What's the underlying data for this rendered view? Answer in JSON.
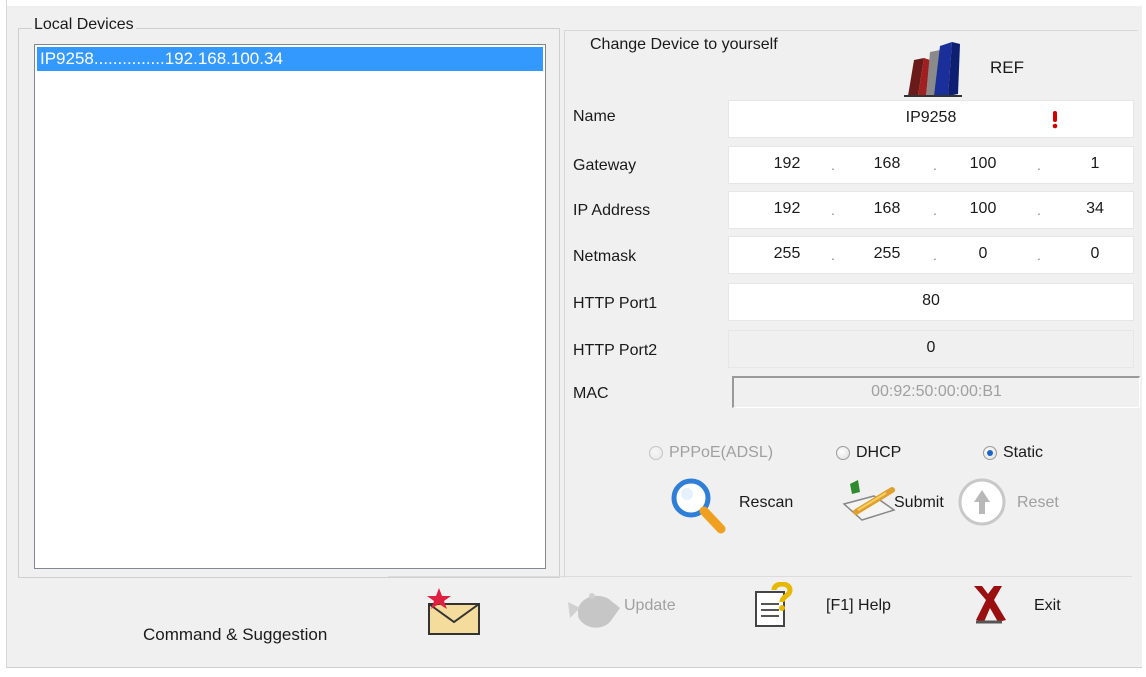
{
  "local_devices": {
    "title": "Local Devices",
    "selected_item": "IP9258...............192.168.100.34"
  },
  "change_panel": {
    "title": "Change Device to yourself",
    "ref_label": "REF",
    "fields": {
      "name_label": "Name",
      "name_value": "IP9258",
      "gateway_label": "Gateway",
      "gateway": [
        "192",
        "168",
        "100",
        "1"
      ],
      "ip_label": "IP Address",
      "ip": [
        "192",
        "168",
        "100",
        "34"
      ],
      "netmask_label": "Netmask",
      "netmask": [
        "255",
        "255",
        "0",
        "0"
      ],
      "port1_label": "HTTP Port1",
      "port1_value": "80",
      "port2_label": "HTTP Port2",
      "port2_value": "0",
      "mac_label": "MAC",
      "mac_value": "00:92:50:00:00:B1"
    },
    "ip_separator": ".",
    "modes": {
      "pppoe": "PPPoE(ADSL)",
      "dhcp": "DHCP",
      "static": "Static",
      "selected": "static"
    },
    "actions": {
      "rescan": "Rescan",
      "submit": "Submit",
      "reset": "Reset"
    }
  },
  "bottom": {
    "command_label": "Command & Suggestion",
    "update": "Update",
    "help": "[F1] Help",
    "exit": "Exit"
  },
  "icons": {
    "ref": "books-icon",
    "required": "exclamation-icon",
    "rescan": "magnifier-icon",
    "submit": "pen-document-icon",
    "reset": "up-arrow-circle-icon",
    "mail": "mail-star-icon",
    "update": "update-icon",
    "help": "help-document-icon",
    "exit": "x-icon"
  },
  "colors": {
    "selection": "#3399ff",
    "window_bg": "#f0f0f0",
    "required": "#d40000"
  }
}
